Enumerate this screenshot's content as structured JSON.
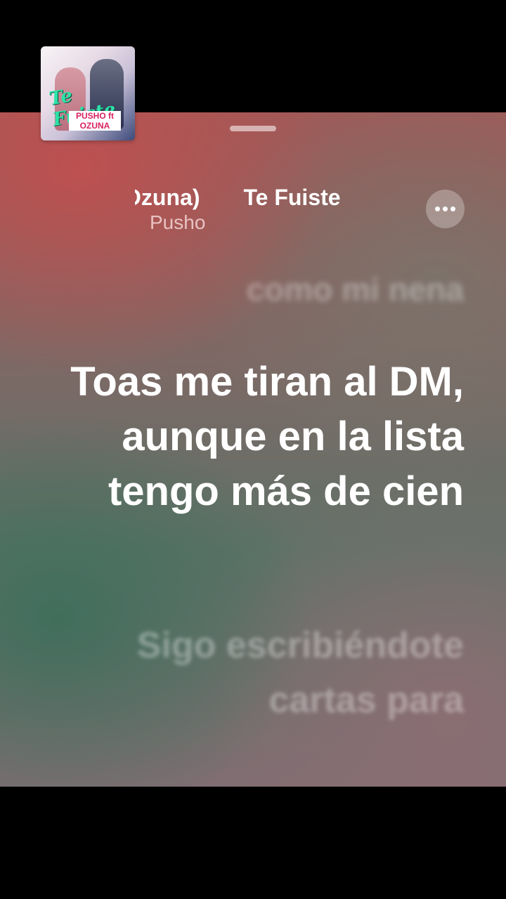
{
  "now_playing": {
    "song_title_scroll": "eat. Ozuna)",
    "song_title_next": "Te Fuiste",
    "artist": "Pusho",
    "artwork": {
      "title_text": "Te Fuiste",
      "band_text": "PUSHO ft OZUNA"
    },
    "more_button_icon": "ellipsis-icon"
  },
  "lyrics": {
    "previous": "como mi nena",
    "current": "Toas me tiran al DM, aunque en la lista tengo más de cien",
    "next": "Sigo escribiéndote cartas para"
  },
  "colors": {
    "background_top": "#9e5a58",
    "background_mid": "#5f7268",
    "background_bottom": "#806e72",
    "active_lyric": "#ffffff"
  }
}
